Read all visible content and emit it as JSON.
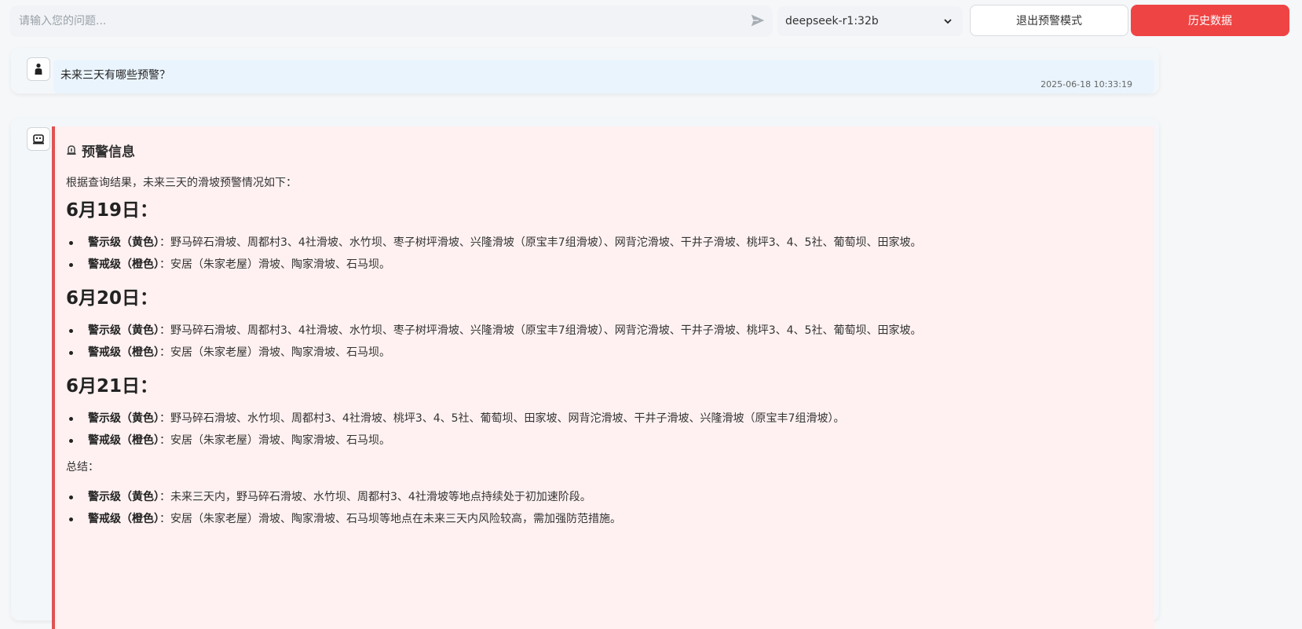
{
  "header": {
    "input_placeholder": "请输入您的问题...",
    "model": "deepseek-r1:32b",
    "exit_label": "退出预警模式",
    "history_label": "历史数据",
    "accent_color": "#ef4444"
  },
  "user_message": {
    "text": "未来三天有哪些预警？",
    "time": "2025-06-18 10:33:19"
  },
  "bot_message": {
    "title": "预警信息",
    "intro": "根据查询结果，未来三天的滑坡预警情况如下：",
    "days": [
      {
        "date": "6月19日：",
        "items": [
          {
            "level": "警示级（黄色）",
            "text": "：野马碎石滑坡、周都村3、4社滑坡、水竹坝、枣子树坪滑坡、兴隆滑坡（原宝丰7组滑坡）、网背沱滑坡、干井子滑坡、桃坪3、4、5社、葡萄坝、田家坡。"
          },
          {
            "level": "警戒级（橙色）",
            "text": "：安居（朱家老屋）滑坡、陶家滑坡、石马坝。"
          }
        ]
      },
      {
        "date": "6月20日：",
        "items": [
          {
            "level": "警示级（黄色）",
            "text": "：野马碎石滑坡、周都村3、4社滑坡、水竹坝、枣子树坪滑坡、兴隆滑坡（原宝丰7组滑坡）、网背沱滑坡、干井子滑坡、桃坪3、4、5社、葡萄坝、田家坡。"
          },
          {
            "level": "警戒级（橙色）",
            "text": "：安居（朱家老屋）滑坡、陶家滑坡、石马坝。"
          }
        ]
      },
      {
        "date": "6月21日：",
        "items": [
          {
            "level": "警示级（黄色）",
            "text": "：野马碎石滑坡、水竹坝、周都村3、4社滑坡、桃坪3、4、5社、葡萄坝、田家坡、网背沱滑坡、干井子滑坡、兴隆滑坡（原宝丰7组滑坡）。"
          },
          {
            "level": "警戒级（橙色）",
            "text": "：安居（朱家老屋）滑坡、陶家滑坡、石马坝。"
          }
        ]
      }
    ],
    "summary_label": "总结：",
    "summary_items": [
      {
        "level": "警示级（黄色）",
        "text": "：未来三天内，野马碎石滑坡、水竹坝、周都村3、4社滑坡等地点持续处于初加速阶段。"
      },
      {
        "level": "警戒级（橙色）",
        "text": "：安居（朱家老屋）滑坡、陶家滑坡、石马坝等地点在未来三天内风险较高，需加强防范措施。"
      }
    ]
  }
}
